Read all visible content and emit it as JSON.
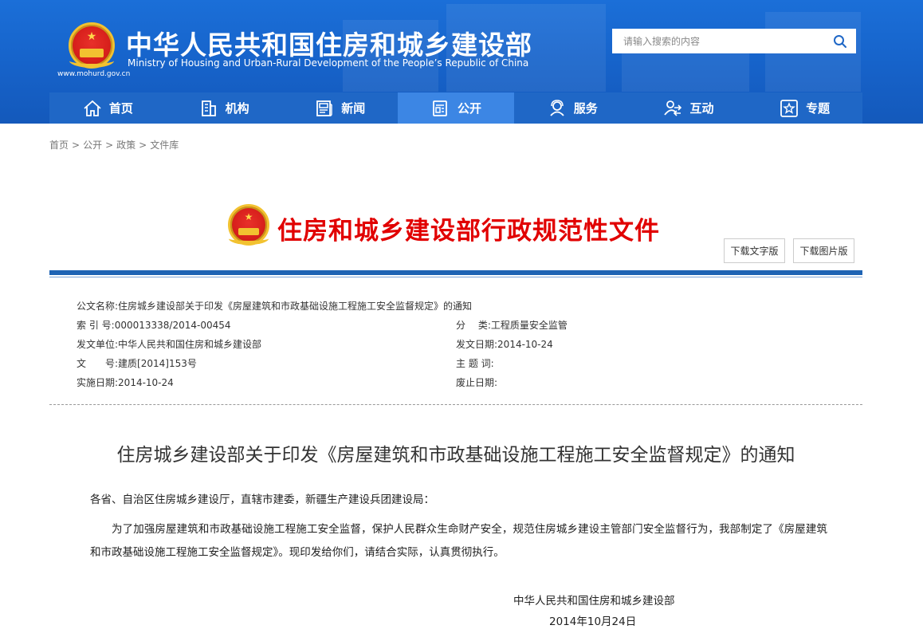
{
  "header": {
    "title": "中华人民共和国住房和城乡建设部",
    "subtitle": "Ministry of Housing and Urban-Rural Development of the People’s Republic of China",
    "url": "www.mohurd.gov.cn",
    "emblem_icon": "national-emblem-icon"
  },
  "search": {
    "placeholder": "请输入搜索的内容",
    "icon": "search-icon"
  },
  "nav": {
    "items": [
      {
        "label": "首页",
        "icon": "home-icon"
      },
      {
        "label": "机构",
        "icon": "building-icon"
      },
      {
        "label": "新闻",
        "icon": "newspaper-icon"
      },
      {
        "label": "公开",
        "icon": "document-icon"
      },
      {
        "label": "服务",
        "icon": "service-icon"
      },
      {
        "label": "互动",
        "icon": "interaction-icon"
      },
      {
        "label": "专题",
        "icon": "star-icon"
      }
    ],
    "active_index": 3
  },
  "breadcrumb": {
    "items": [
      "首页",
      "公开",
      "政策",
      "文件库"
    ],
    "separator": ">"
  },
  "doc_banner": {
    "title": "住房和城乡建设部行政规范性文件",
    "download_text": "下载文字版",
    "download_image": "下载图片版"
  },
  "meta": {
    "name_label": "公文名称:",
    "name_value": "住房城乡建设部关于印发《房屋建筑和市政基础设施工程施工安全监督规定》的通知",
    "index_label": "索 引 号:",
    "index_value": "000013338/2014-00454",
    "category_label": "分　 类:",
    "category_value": "工程质量安全监管",
    "issuer_label": "发文单位:",
    "issuer_value": "中华人民共和国住房和城乡建设部",
    "issue_date_label": "发文日期:",
    "issue_date_value": "2014-10-24",
    "docno_label": "文　　号:",
    "docno_value": "建质[2014]153号",
    "subject_label": "主 题 词:",
    "subject_value": "",
    "effective_label": "实施日期:",
    "effective_value": "2014-10-24",
    "expire_label": "废止日期:",
    "expire_value": ""
  },
  "document": {
    "title": "住房城乡建设部关于印发《房屋建筑和市政基础设施工程施工安全监督规定》的通知",
    "salutation": "各省、自治区住房城乡建设厅，直辖市建委，新疆生产建设兵团建设局：",
    "body": "为了加强房屋建筑和市政基础设施工程施工安全监督，保护人民群众生命财产安全，规范住房城乡建设主管部门安全监督行为，我部制定了《房屋建筑和市政基础设施工程施工安全监督规定》。现印发给你们，请结合实际，认真贯彻执行。",
    "sign_org": "中华人民共和国住房和城乡建设部",
    "sign_date": "2014年10月24日"
  },
  "colors": {
    "header_blue": "#1b6fd8",
    "nav_blue": "#1f67c6",
    "nav_active": "#3c86e4",
    "banner_red": "#e10000",
    "rule_blue": "#1e63b4"
  }
}
